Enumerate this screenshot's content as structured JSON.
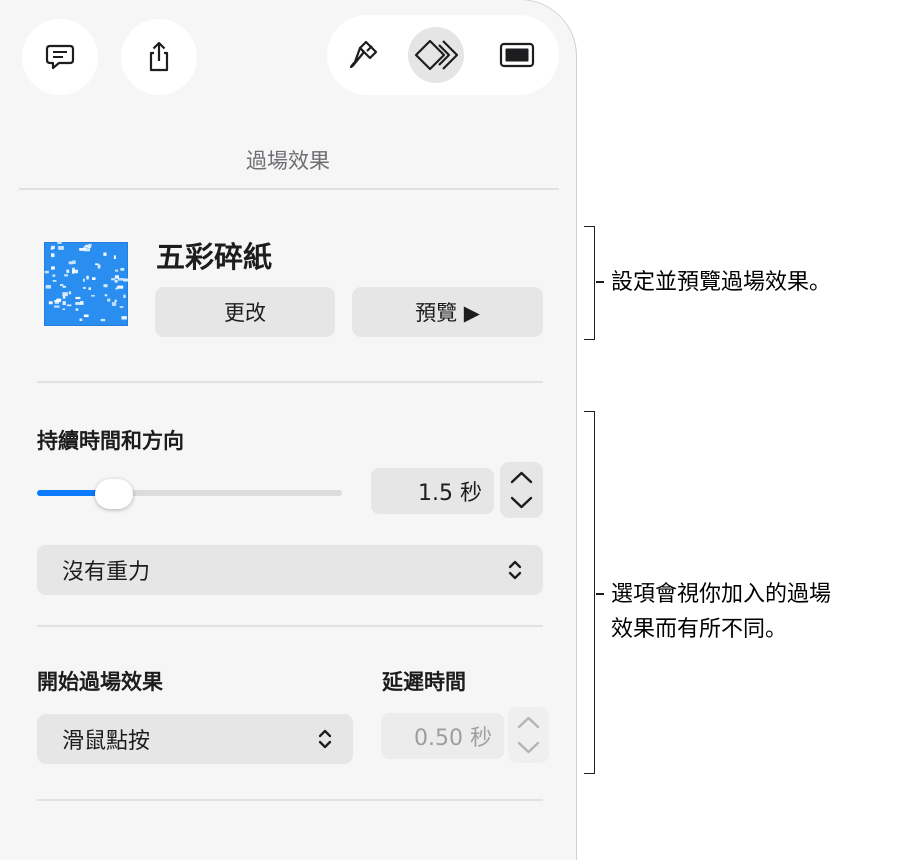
{
  "toolbar": {
    "left_buttons": [
      "comment-icon",
      "share-icon"
    ],
    "right_buttons": [
      "format-brush-icon",
      "animate-icon",
      "document-icon"
    ],
    "active": "animate-icon"
  },
  "panel": {
    "heading": "過場效果",
    "transition": {
      "name": "五彩碎紙",
      "change_label": "更改",
      "preview_label": "預覽 ▶"
    },
    "duration": {
      "label": "持續時間和方向",
      "value_text": "1.5 秒",
      "slider_fraction": 0.27
    },
    "gravity_select": "沒有重力",
    "start": {
      "label": "開始過場效果",
      "select": "滑鼠點按"
    },
    "delay": {
      "label": "延遲時間",
      "value_text": "0.50 秒"
    }
  },
  "callouts": {
    "top": "設定並預覽過場效果。",
    "bottom_line1": "選項會視你加入的過場",
    "bottom_line2": "效果而有所不同。"
  },
  "colors": {
    "accent": "#0a7aff",
    "panel_bg": "#f6f6f6",
    "control_bg": "#e6e6e6"
  }
}
